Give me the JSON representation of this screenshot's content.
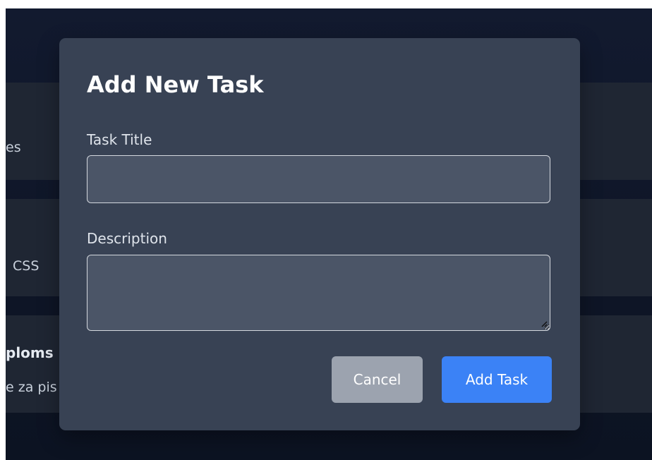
{
  "background": {
    "card1_text": "es",
    "card2_text": "CSS",
    "card3_title": "ploms",
    "card3_text": "e za pis"
  },
  "modal": {
    "title": "Add New Task",
    "task_title_label": "Task Title",
    "task_title_value": "",
    "description_label": "Description",
    "description_value": "",
    "cancel_label": "Cancel",
    "add_label": "Add Task"
  },
  "colors": {
    "modal_bg": "#384254",
    "input_bg": "#4b5567",
    "cancel_bg": "#9ca3af",
    "primary": "#3b82f6"
  }
}
